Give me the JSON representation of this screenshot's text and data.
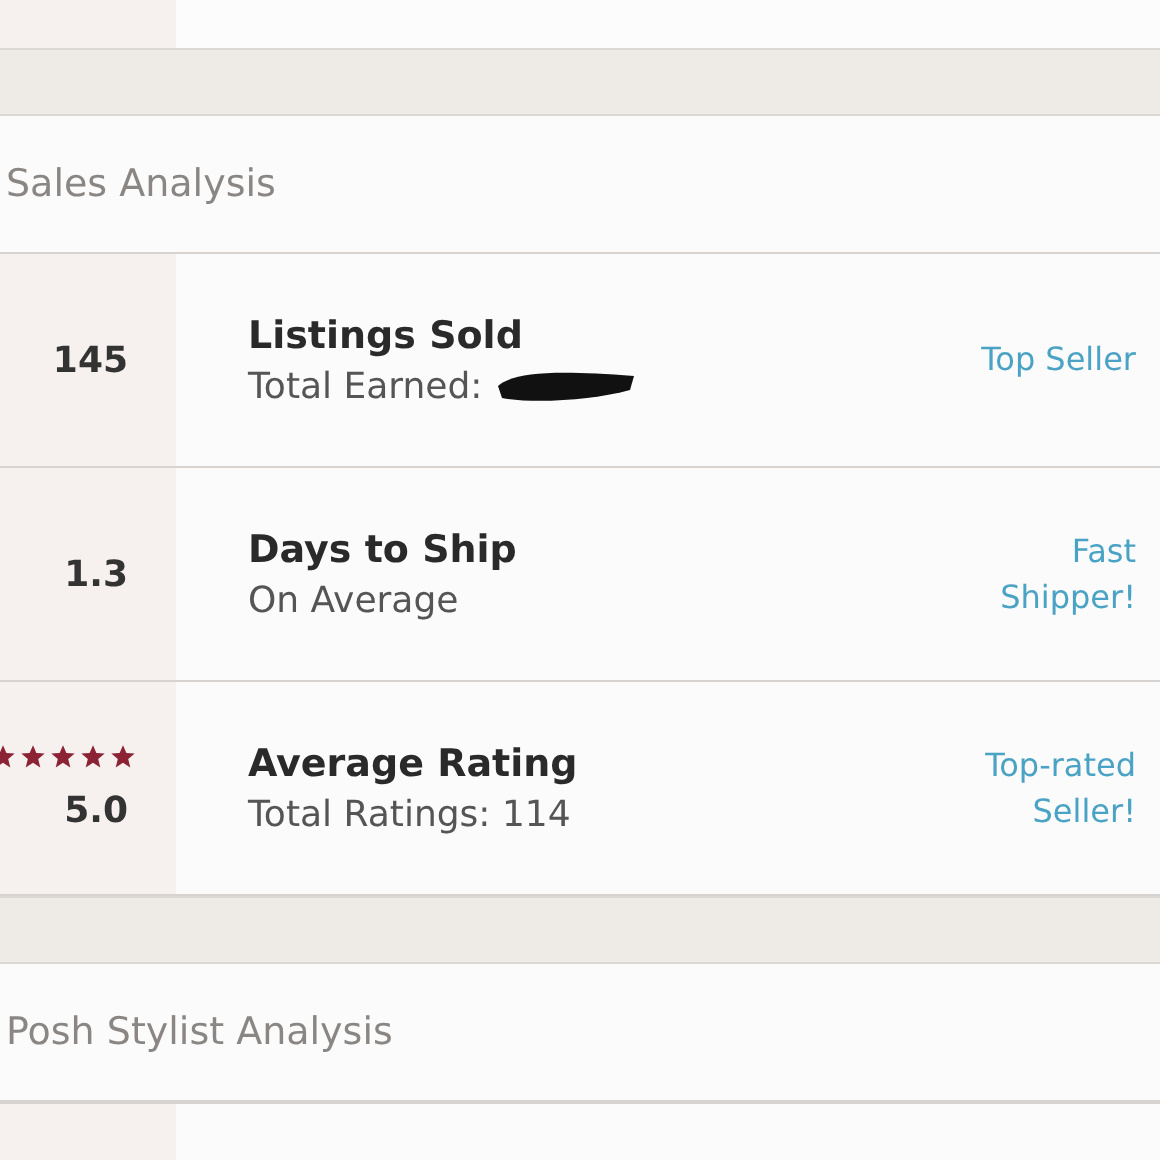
{
  "sections": [
    {
      "title": "Sales Analysis",
      "rows": [
        {
          "kind": "count",
          "value": "145",
          "title": "Listings Sold",
          "subtitle": "Total Earned:",
          "redacted": true,
          "badge": "Top Seller"
        },
        {
          "kind": "count",
          "value": "1.3",
          "title": "Days to Ship",
          "subtitle": "On Average",
          "badge": "Fast Shipper!"
        },
        {
          "kind": "rating",
          "stars": 5,
          "value": "5.0",
          "title": "Average Rating",
          "subtitle": "Total Ratings: 114",
          "badge": "Top-rated Seller!"
        }
      ]
    },
    {
      "title": "Posh Stylist Analysis"
    }
  ]
}
